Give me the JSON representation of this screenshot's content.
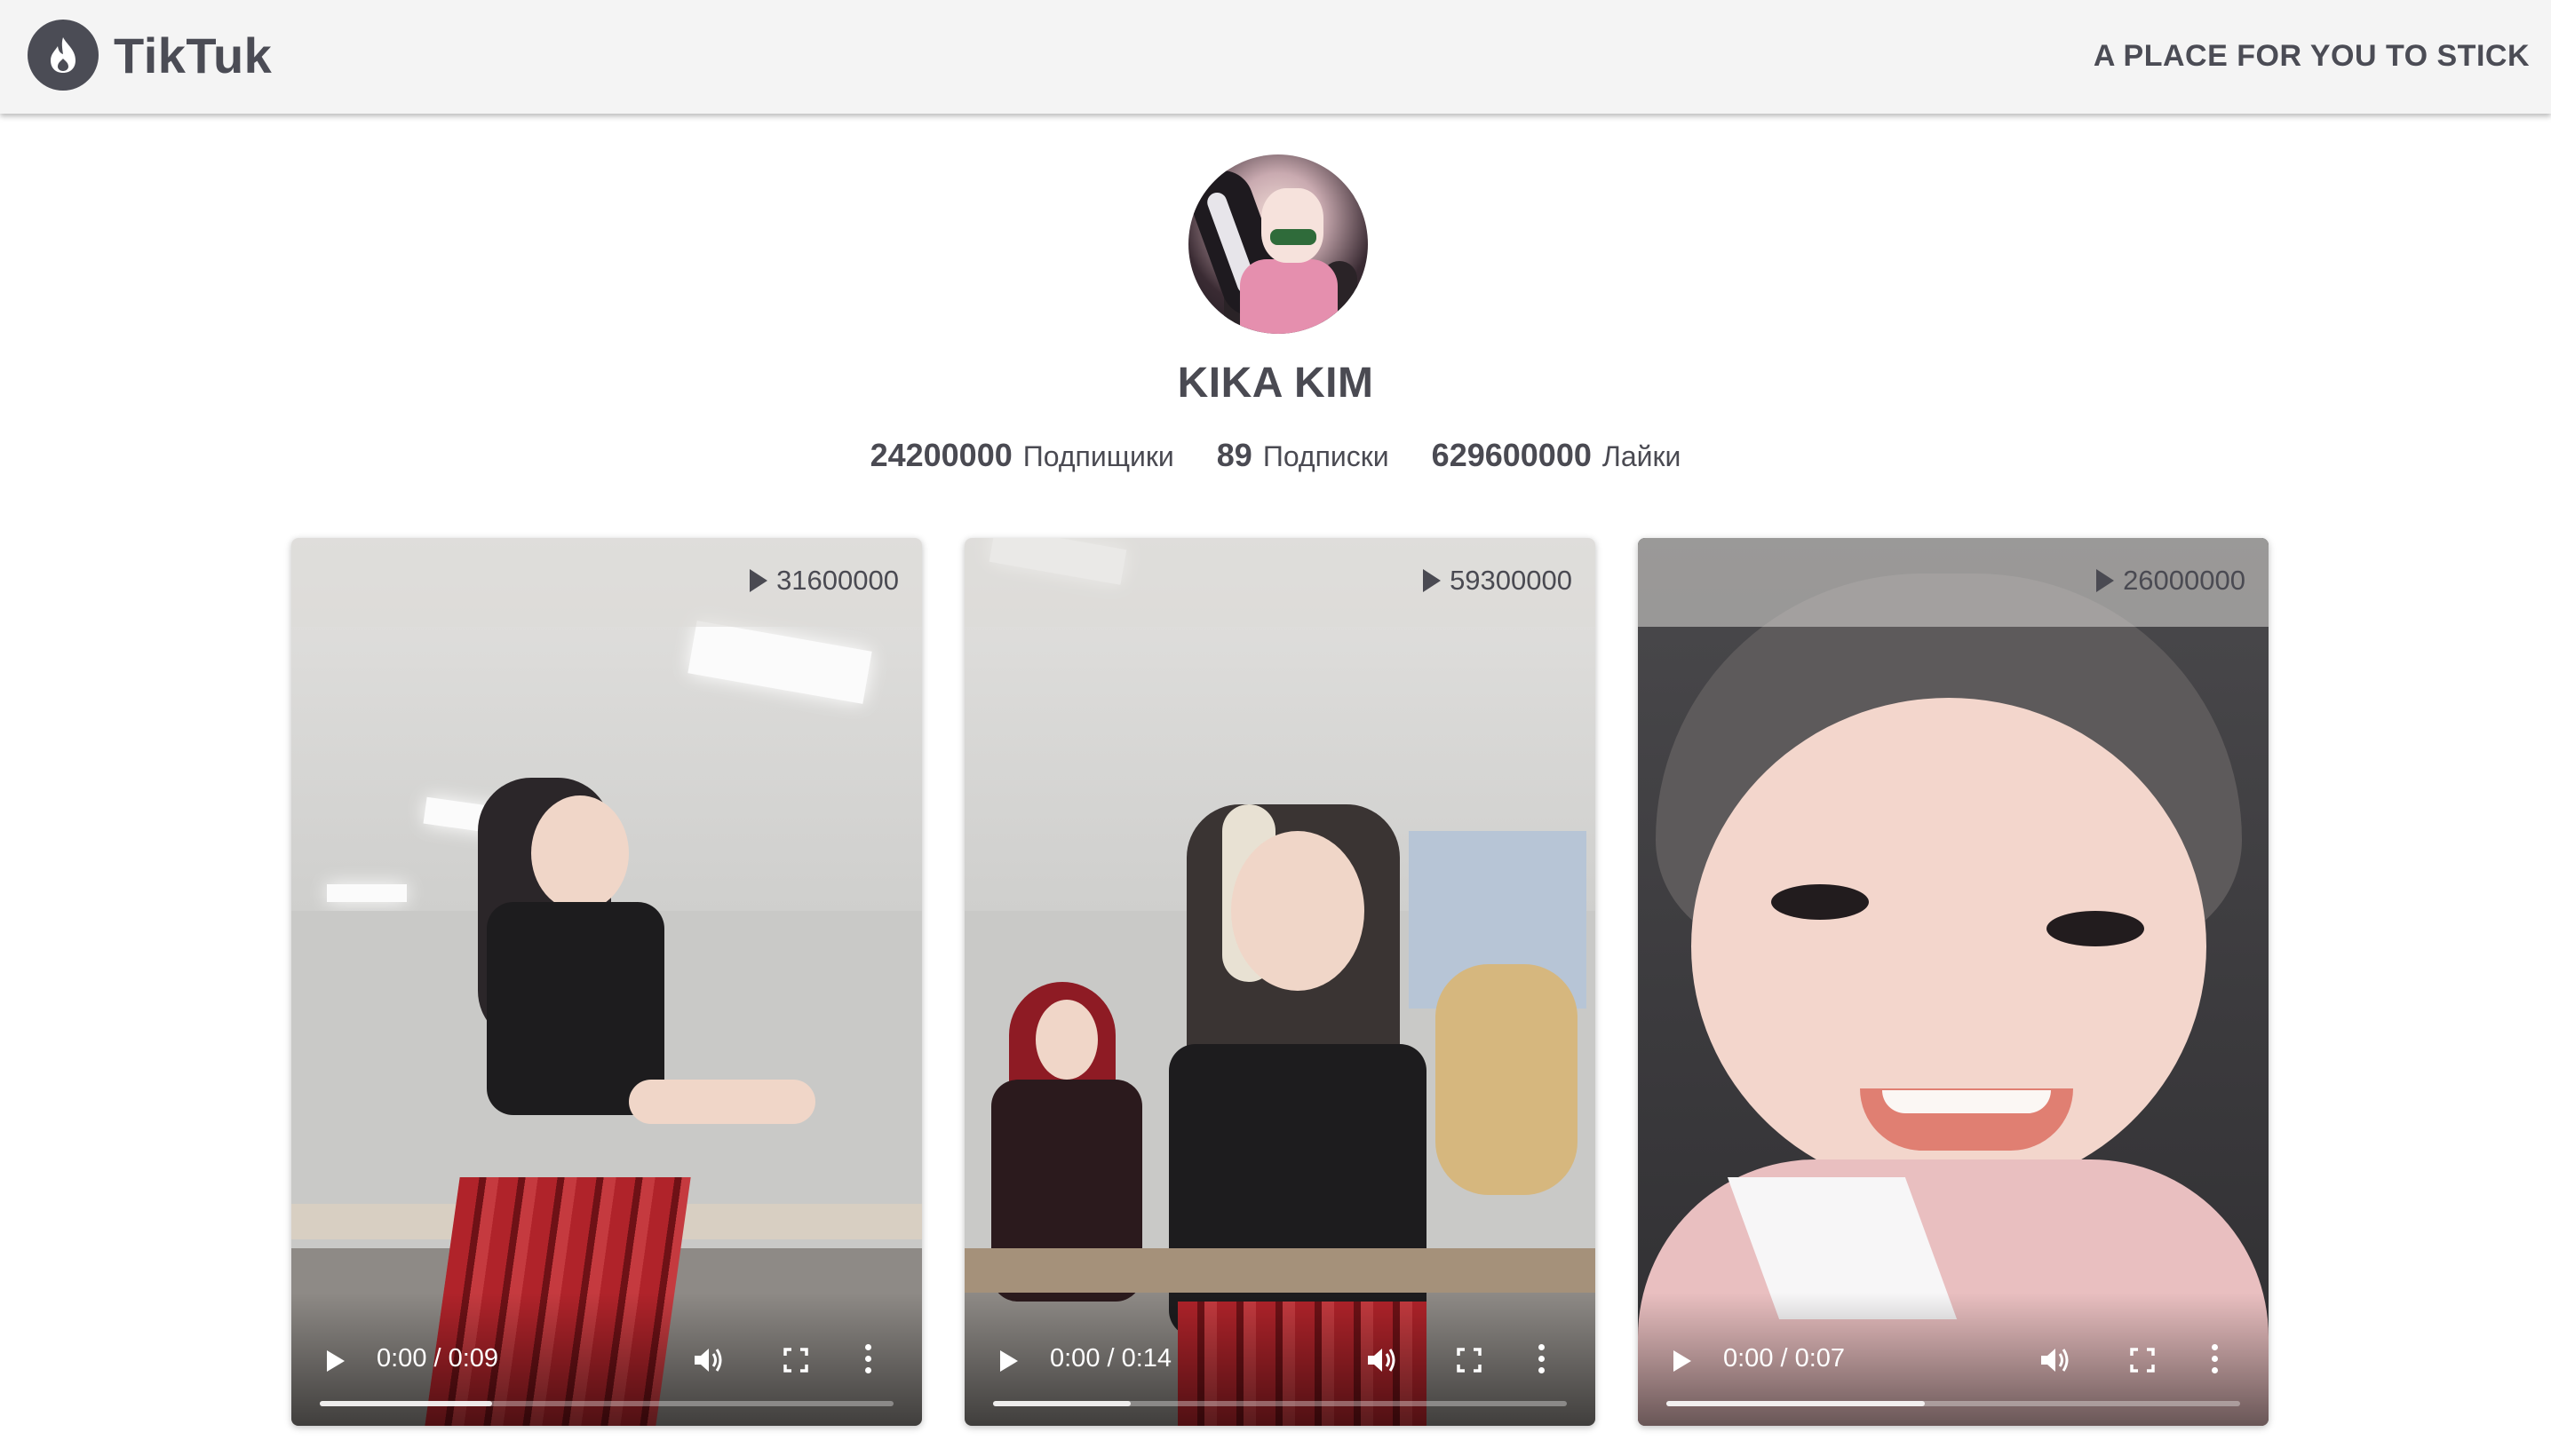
{
  "header": {
    "brand": "TikTuk",
    "tagline": "A PLACE FOR YOU TO STICK",
    "logo_icon": "flame-icon"
  },
  "profile": {
    "username": "KIKA KIM",
    "stats": [
      {
        "value": "24200000",
        "label": "Подпищики"
      },
      {
        "value": "89",
        "label": "Подписки"
      },
      {
        "value": "629600000",
        "label": "Лайки"
      }
    ]
  },
  "videos": [
    {
      "views": "31600000",
      "time": "0:00 / 0:09",
      "progress": 0.3
    },
    {
      "views": "59300000",
      "time": "0:00 / 0:14",
      "progress": 0.24
    },
    {
      "views": "26000000",
      "time": "0:00 / 0:07",
      "progress": 0.45
    }
  ],
  "colors": {
    "header_bg": "#f4f4f4",
    "text": "#4a4a52",
    "logo_bg": "#4b4c55"
  }
}
